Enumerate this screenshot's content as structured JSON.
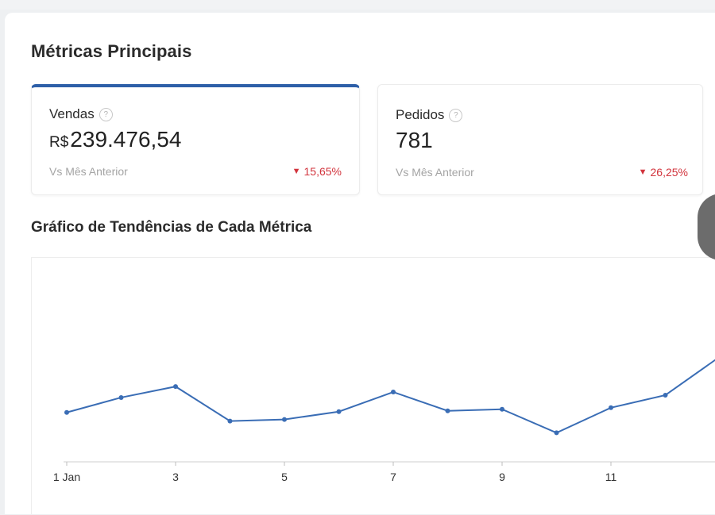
{
  "section": {
    "title": "Métricas Principais"
  },
  "cards": {
    "sales": {
      "label": "Vendas",
      "help_icon": "?",
      "currency": "R$",
      "value": "239.476,54",
      "compare_label": "Vs Mês Anterior",
      "delta": "15,65%",
      "delta_direction": "down"
    },
    "orders": {
      "label": "Pedidos",
      "help_icon": "?",
      "value": "781",
      "compare_label": "Vs Mês Anterior",
      "delta": "26,25%",
      "delta_direction": "down"
    }
  },
  "icons": {
    "delta_down": "▼"
  },
  "colors": {
    "accent": "#2d5fa8",
    "line": "#3a6db5",
    "negative": "#d2343d"
  },
  "chart": {
    "title": "Gráfico de Tendências de Cada Métrica"
  },
  "chart_data": {
    "type": "line",
    "title": "Gráfico de Tendências de Cada Métrica",
    "xlabel": "",
    "ylabel": "",
    "x": [
      1,
      2,
      3,
      4,
      5,
      6,
      7,
      8,
      9,
      10,
      11,
      12,
      13
    ],
    "x_tick_labels": [
      "1 Jan",
      "3",
      "5",
      "7",
      "9",
      "11"
    ],
    "x_tick_values": [
      1,
      3,
      5,
      7,
      9,
      11
    ],
    "series": [
      {
        "values": [
          63,
          82,
          96,
          52,
          54,
          64,
          89,
          65,
          67,
          37,
          69,
          85,
          134
        ]
      }
    ],
    "ylim": [
      0,
      260
    ],
    "grid": false,
    "legend": "none"
  }
}
